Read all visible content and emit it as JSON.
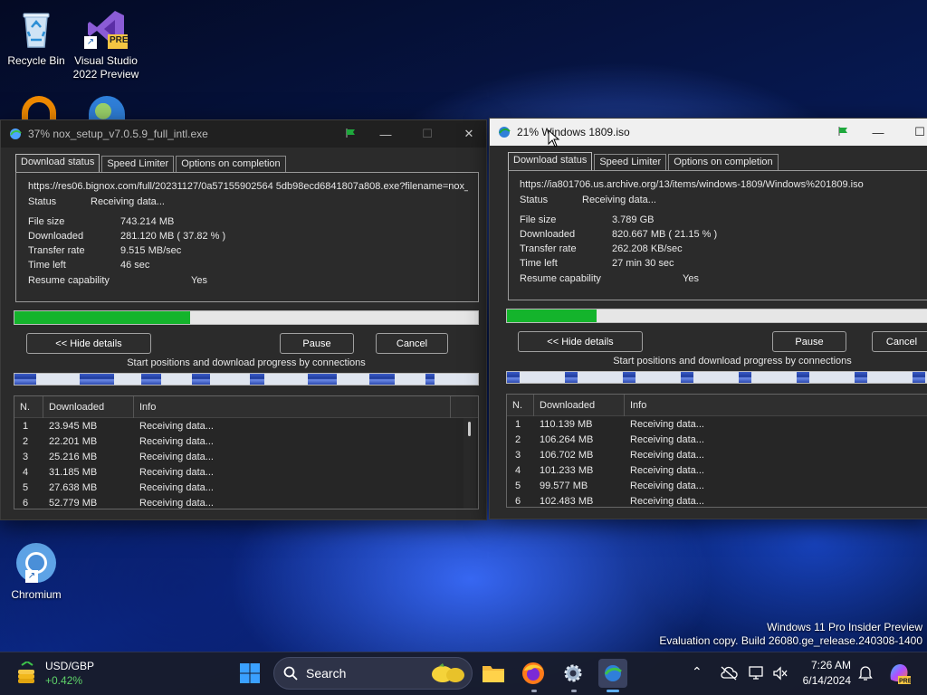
{
  "desktop": {
    "icons": [
      {
        "label": "Recycle Bin",
        "icon": "recycle-bin-icon"
      },
      {
        "label": "Visual Studio 2022 Preview",
        "badge": "PRE",
        "icon": "visual-studio-icon"
      },
      {
        "label": "Chromium",
        "icon": "chromium-icon"
      }
    ],
    "watermark": {
      "line1": "Windows 11 Pro Insider Preview",
      "line2": "Evaluation copy. Build 26080.ge_release.240308-1400"
    }
  },
  "window1": {
    "title": "37% nox_setup_v7.0.5.9_full_intl.exe",
    "tabs": [
      "Download status",
      "Speed Limiter",
      "Options on completion"
    ],
    "url": "https://res06.bignox.com/full/20231127/0a57155902564 5db98ecd6841807a808.exe?filename=nox_",
    "status_label": "Status",
    "status_value": "Receiving data...",
    "fields": [
      {
        "label": "File size",
        "value": "743.214  MB"
      },
      {
        "label": "Downloaded",
        "value": "281.120  MB  ( 37.82 % )"
      },
      {
        "label": "Transfer rate",
        "value": "9.515  MB/sec"
      },
      {
        "label": "Time left",
        "value": "46 sec"
      }
    ],
    "resume_label": "Resume capability",
    "resume_value": "Yes",
    "progress": 0.3782,
    "buttons": {
      "hide": "<< Hide details",
      "pause": "Pause",
      "cancel": "Cancel"
    },
    "connections_caption": "Start positions and download progress by connections",
    "table_headers": [
      "N.",
      "Downloaded",
      "Info"
    ],
    "rows": [
      {
        "n": "1",
        "downloaded": "23.945  MB",
        "info": "Receiving data..."
      },
      {
        "n": "2",
        "downloaded": "22.201  MB",
        "info": "Receiving data..."
      },
      {
        "n": "3",
        "downloaded": "25.216  MB",
        "info": "Receiving data..."
      },
      {
        "n": "4",
        "downloaded": "31.185  MB",
        "info": "Receiving data..."
      },
      {
        "n": "5",
        "downloaded": "27.638  MB",
        "info": "Receiving data..."
      },
      {
        "n": "6",
        "downloaded": "52.779  MB",
        "info": "Receiving data..."
      }
    ]
  },
  "window2": {
    "title": "21% Windows 1809.iso",
    "tabs": [
      "Download status",
      "Speed Limiter",
      "Options on completion"
    ],
    "url": "https://ia801706.us.archive.org/13/items/windows-1809/Windows%201809.iso",
    "status_label": "Status",
    "status_value": "Receiving data...",
    "fields": [
      {
        "label": "File size",
        "value": "3.789  GB"
      },
      {
        "label": "Downloaded",
        "value": "820.667  MB  ( 21.15 % )"
      },
      {
        "label": "Transfer rate",
        "value": "262.208  KB/sec"
      },
      {
        "label": "Time left",
        "value": "27 min 30 sec"
      }
    ],
    "resume_label": "Resume capability",
    "resume_value": "Yes",
    "progress": 0.2115,
    "buttons": {
      "hide": "<< Hide details",
      "pause": "Pause",
      "cancel": "Cancel"
    },
    "connections_caption": "Start positions and download progress by connections",
    "table_headers": [
      "N.",
      "Downloaded",
      "Info"
    ],
    "rows": [
      {
        "n": "1",
        "downloaded": "110.139  MB",
        "info": "Receiving data..."
      },
      {
        "n": "2",
        "downloaded": "106.264  MB",
        "info": "Receiving data..."
      },
      {
        "n": "3",
        "downloaded": "106.702  MB",
        "info": "Receiving data..."
      },
      {
        "n": "4",
        "downloaded": "101.233  MB",
        "info": "Receiving data..."
      },
      {
        "n": "5",
        "downloaded": "99.577  MB",
        "info": "Receiving data..."
      },
      {
        "n": "6",
        "downloaded": "102.483  MB",
        "info": "Receiving data..."
      }
    ]
  },
  "taskbar": {
    "widget": {
      "title": "USD/GBP",
      "value": "+0.42%",
      "value_color": "#5fd36a"
    },
    "search_placeholder": "Search",
    "clock": {
      "time": "7:26 AM",
      "date": "6/14/2024"
    },
    "accent": "#0078d4"
  }
}
